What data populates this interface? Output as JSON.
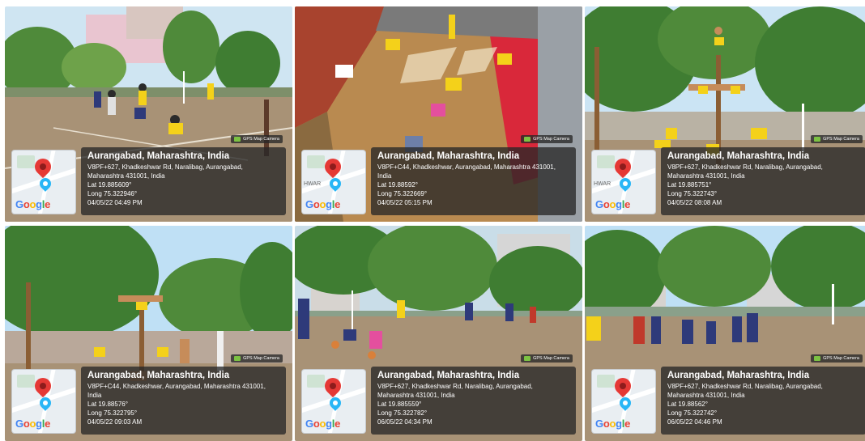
{
  "brand": "Google",
  "badge_text": "GPS Map Camera",
  "tiles": [
    {
      "city": "Aurangabad, Maharashtra, India",
      "address": "V8PF+627, Khadkeshwar Rd, Naralibag, Aurangabad, Maharashtra 431001, India",
      "lat": "Lat 19.885609°",
      "long": "Long 75.322946°",
      "datetime": "04/05/22 04:49 PM",
      "map_text": ""
    },
    {
      "city": "Aurangabad, Maharashtra, India",
      "address": "V8PF+C44, Khadkeshwar, Aurangabad, Maharashtra 431001, India",
      "lat": "Lat 19.88592°",
      "long": "Long 75.322669°",
      "datetime": "04/05/22 05:15 PM",
      "map_text": "HWAR"
    },
    {
      "city": "Aurangabad, Maharashtra, India",
      "address": "V8PF+627, Khadkeshwar Rd, Naralibag, Aurangabad, Maharashtra 431001, India",
      "lat": "Lat 19.885751°",
      "long": "Long 75.322743°",
      "datetime": "04/05/22 08:08 AM",
      "map_text": "HWAR"
    },
    {
      "city": "Aurangabad, Maharashtra, India",
      "address": "V8PF+C44, Khadkeshwar, Aurangabad, Maharashtra 431001, India",
      "lat": "Lat 19.88576°",
      "long": "Long 75.322795°",
      "datetime": "04/05/22 09:03 AM",
      "map_text": ""
    },
    {
      "city": "Aurangabad, Maharashtra, India",
      "address": "V8PF+627, Khadkeshwar Rd, Naralibag, Aurangabad, Maharashtra 431001, India",
      "lat": "Lat 19.885559°",
      "long": "Long 75.322782°",
      "datetime": "06/05/22 04:34 PM",
      "map_text": ""
    },
    {
      "city": "Aurangabad, Maharashtra, India",
      "address": "V8PF+627, Khadkeshwar Rd, Naralibag, Aurangabad, Maharashtra 431001, India",
      "lat": "Lat 19.88562°",
      "long": "Long 75.322742°",
      "datetime": "06/05/22 04:46 PM",
      "map_text": ""
    }
  ],
  "colors": {
    "overlay_bg": "#2b2b2b",
    "pin_red": "#e53935",
    "pin_blue": "#29b6f6",
    "jersey_yellow": "#f4d11a",
    "mat_red": "#d9283a",
    "ground": "#a89276",
    "foliage": "#3f7d32",
    "sky": "#bfe0f5"
  }
}
